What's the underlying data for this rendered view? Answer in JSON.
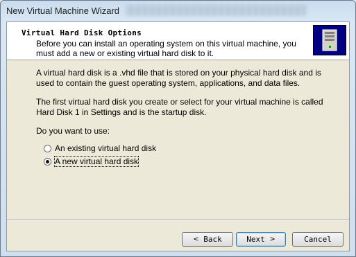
{
  "window": {
    "title": "New Virtual Machine Wizard"
  },
  "header": {
    "title": "Virtual Hard Disk Options",
    "subtitle": "Before you can install an operating system on this virtual machine, you must add a new or existing virtual hard disk to it.",
    "icon": "server-icon"
  },
  "body": {
    "paragraph1": "A virtual hard disk is a .vhd file that is stored on your physical hard disk and is used to contain the guest operating system, applications, and data files.",
    "paragraph2": "The first virtual hard disk you create or select for your virtual machine is called Hard Disk 1 in Settings and is the startup disk.",
    "question": "Do you want to use:",
    "options": [
      {
        "label": "An existing virtual hard disk",
        "selected": false
      },
      {
        "label": "A new virtual hard disk",
        "selected": true
      }
    ]
  },
  "buttons": {
    "back": "Back",
    "back_arrow": "<",
    "next": "Next",
    "next_arrow": ">",
    "cancel": "Cancel"
  }
}
